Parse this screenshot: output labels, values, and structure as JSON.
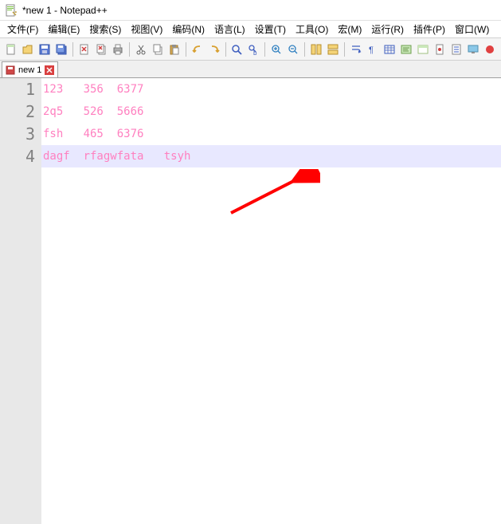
{
  "window": {
    "title": "*new 1 - Notepad++"
  },
  "menu": {
    "items": [
      "文件(F)",
      "编辑(E)",
      "搜索(S)",
      "视图(V)",
      "编码(N)",
      "语言(L)",
      "设置(T)",
      "工具(O)",
      "宏(M)",
      "运行(R)",
      "插件(P)",
      "窗口(W)"
    ]
  },
  "toolbar": {
    "icons": [
      "new-file",
      "open-file",
      "save",
      "save-all",
      "sep",
      "close",
      "close-all",
      "print",
      "sep",
      "cut",
      "copy",
      "paste",
      "sep",
      "undo",
      "redo",
      "sep",
      "find",
      "replace",
      "sep",
      "zoom-in",
      "zoom-out",
      "sep",
      "sync-v",
      "sync-h",
      "sep",
      "wrap",
      "all-chars",
      "indent-guide",
      "lang",
      "folder",
      "doc-map",
      "func-list",
      "monitor",
      "record"
    ]
  },
  "tabs": [
    {
      "label": "new 1",
      "modified": true
    }
  ],
  "editor": {
    "lines": [
      "123   356  6377",
      "2q5   526  5666",
      "fsh   465  6376",
      "dagf  rfagwfata   tsyh"
    ],
    "currentLine": 4
  }
}
